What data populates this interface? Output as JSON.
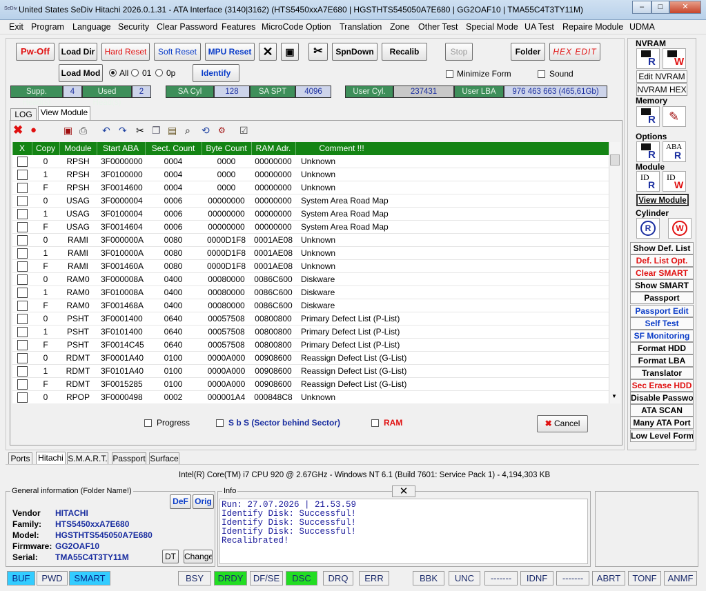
{
  "window": {
    "title": "United States  SeDiv Hitachi  2026.0.1.31 - ATA Interface  (3140|3162)  (HTS5450xxA7E680 | HGSTHTS545050A7E680 | GG2OAF10 | TMA55C4T3TY11M)",
    "app_icon": "SeDiv",
    "min": "–",
    "max": "□",
    "close": "✕"
  },
  "menu": [
    "Exit",
    "Program",
    "Language",
    "Security",
    "Clear Password",
    "Features",
    "MicroCode Option",
    "Translation",
    "Zone",
    "Other Test",
    "Special Mode",
    "UA Test",
    "Repaire Module",
    "UDMA"
  ],
  "toolbar": {
    "pwoff": "Pw-Off",
    "loaddir": "Load Dir",
    "hardreset": "Hard Reset",
    "softreset": "Soft Reset",
    "mpureset": "MPU Reset",
    "spndown": "SpnDown",
    "recalib": "Recalib",
    "stop": "Stop",
    "folder": "Folder",
    "hexedit": "HEX EDIT",
    "loadmod": "Load Mod",
    "radio_all": "All",
    "radio_01": "01",
    "radio_0p": "0p",
    "identify": "Identify",
    "minimize": "Minimize Form",
    "sound": "Sound"
  },
  "infobar": {
    "supp_label": "Supp. Head(s)",
    "supp": "4",
    "used_label": "Used Head(s)",
    "used": "2",
    "sacyl_label": "SA Cyl",
    "sacyl": "128",
    "saspt_label": "SA SPT",
    "saspt": "4096",
    "usercyl_label": "User Cyl.",
    "usercyl": "237431",
    "userlba_label": "User LBA",
    "userlba": "976 463 663  (465,61Gb)"
  },
  "tabs": {
    "log": "LOG",
    "view": "View Module"
  },
  "grid": {
    "headers": [
      "X",
      "Copy",
      "Module",
      "Start ABA",
      "Sect. Count",
      "Byte Count",
      "RAM Adr.",
      "Comment !!!"
    ],
    "rows": [
      [
        "0",
        "RPSH",
        "3F0000000",
        "0004",
        "0000",
        "00000000",
        "Unknown"
      ],
      [
        "1",
        "RPSH",
        "3F0100000",
        "0004",
        "0000",
        "00000000",
        "Unknown"
      ],
      [
        "F",
        "RPSH",
        "3F0014600",
        "0004",
        "0000",
        "00000000",
        "Unknown"
      ],
      [
        "0",
        "USAG",
        "3F0000004",
        "0006",
        "00000000",
        "00000000",
        "System Area Road Map"
      ],
      [
        "1",
        "USAG",
        "3F0100004",
        "0006",
        "00000000",
        "00000000",
        "System Area Road Map"
      ],
      [
        "F",
        "USAG",
        "3F0014604",
        "0006",
        "00000000",
        "00000000",
        "System Area Road Map"
      ],
      [
        "0",
        "RAMI",
        "3F000000A",
        "0080",
        "0000D1F8",
        "0001AE08",
        "Unknown"
      ],
      [
        "1",
        "RAMI",
        "3F010000A",
        "0080",
        "0000D1F8",
        "0001AE08",
        "Unknown"
      ],
      [
        "F",
        "RAMI",
        "3F001460A",
        "0080",
        "0000D1F8",
        "0001AE08",
        "Unknown"
      ],
      [
        "0",
        "RAM0",
        "3F000008A",
        "0400",
        "00080000",
        "0086C600",
        "Diskware"
      ],
      [
        "1",
        "RAM0",
        "3F010008A",
        "0400",
        "00080000",
        "0086C600",
        "Diskware"
      ],
      [
        "F",
        "RAM0",
        "3F001468A",
        "0400",
        "00080000",
        "0086C600",
        "Diskware"
      ],
      [
        "0",
        "PSHT",
        "3F0001400",
        "0640",
        "00057508",
        "00800800",
        "Primary Defect List (P-List)"
      ],
      [
        "1",
        "PSHT",
        "3F0101400",
        "0640",
        "00057508",
        "00800800",
        "Primary Defect List (P-List)"
      ],
      [
        "F",
        "PSHT",
        "3F0014C45",
        "0640",
        "00057508",
        "00800800",
        "Primary Defect List (P-List)"
      ],
      [
        "0",
        "RDMT",
        "3F0001A40",
        "0100",
        "0000A000",
        "00908600",
        "Reassign Defect List (G-List)"
      ],
      [
        "1",
        "RDMT",
        "3F0101A40",
        "0100",
        "0000A000",
        "00908600",
        "Reassign Defect List (G-List)"
      ],
      [
        "F",
        "RDMT",
        "3F0015285",
        "0100",
        "0000A000",
        "00908600",
        "Reassign Defect List (G-List)"
      ],
      [
        "0",
        "RPOP",
        "3F0000498",
        "0002",
        "000001A4",
        "000848C8",
        "Unknown"
      ]
    ]
  },
  "bottom_opts": {
    "progress": "Progress",
    "sbs": "S b S (Sector behind Sector)",
    "ram": "RAM",
    "cancel": "Cancel"
  },
  "right": {
    "nvram": "NVRAM",
    "edit_nvram": "Edit NVRAM",
    "nvram_hex": "NVRAM HEX",
    "memory": "Memory",
    "options": "Options",
    "aba": "ABA",
    "module": "Module",
    "id": "ID",
    "view_module": "View Module",
    "cylinder": "Cylinder",
    "r": "R",
    "w": "W",
    "buttons": [
      {
        "t": "Show Def. List",
        "c": "#000"
      },
      {
        "t": "Def. List Opt.",
        "c": "#e01010"
      },
      {
        "t": "Clear SMART",
        "c": "#e01010"
      },
      {
        "t": "Show SMART",
        "c": "#000"
      },
      {
        "t": "Passport",
        "c": "#000"
      },
      {
        "t": "Passport Edit",
        "c": "#0a3cc8"
      },
      {
        "t": "Self Test",
        "c": "#0a3cc8"
      },
      {
        "t": "SF Monitoring",
        "c": "#0a3cc8"
      },
      {
        "t": "Format HDD",
        "c": "#000"
      },
      {
        "t": "Format LBA",
        "c": "#000"
      },
      {
        "t": "Translator",
        "c": "#000"
      },
      {
        "t": "Sec Erase HDD",
        "c": "#e01010"
      },
      {
        "t": "Disable Password",
        "c": "#000"
      },
      {
        "t": "ATA SCAN",
        "c": "#000"
      },
      {
        "t": "Many ATA Port",
        "c": "#000"
      },
      {
        "t": "Low Level Format",
        "c": "#000"
      }
    ]
  },
  "bottom_tabs": [
    "Ports",
    "Hitachi",
    "S.M.A.R.T.",
    "Passport",
    "Surface"
  ],
  "sysinfo": "Intel(R) Core(TM) i7 CPU 920  @ 2.67GHz - Windows NT 6.1 (Build 7601: Service Pack 1) -  4,194,303 KB",
  "general": {
    "title": "General information (Folder Name!)",
    "def": "DeF",
    "orig": "Orig",
    "vendor_l": "Vendor",
    "vendor": "HITACHI",
    "family_l": "Family:",
    "family": "HTS5450xxA7E680",
    "model_l": "Model:",
    "model": "HGSTHTS545050A7E680",
    "fw_l": "Firmware:",
    "fw": "GG2OAF10",
    "serial_l": "Serial:",
    "serial": "TMA55C4T3TY11M",
    "dt": "DT",
    "change": "Change"
  },
  "log": {
    "title": "Info",
    "lines": "Run: 27.07.2026 | 21.53.59\nIdentify Disk: Successful!\nIdentify Disk: Successful!\nIdentify Disk: Successful!\nRecalibrated!"
  },
  "status": [
    {
      "t": "BUF",
      "bg": "#33ccff"
    },
    {
      "t": "PWD",
      "bg": "#f0f0f0"
    },
    {
      "t": "SMART",
      "bg": "#33ccff"
    },
    {
      "t": "BSY",
      "bg": "#f0f0f0"
    },
    {
      "t": "DRDY",
      "bg": "#22dd22"
    },
    {
      "t": "DF/SE",
      "bg": "#f0f0f0"
    },
    {
      "t": "DSC",
      "bg": "#22dd22"
    },
    {
      "t": "DRQ",
      "bg": "#f0f0f0"
    },
    {
      "t": "ERR",
      "bg": "#f0f0f0"
    },
    {
      "t": "BBK",
      "bg": "#f0f0f0"
    },
    {
      "t": "UNC",
      "bg": "#f0f0f0"
    },
    {
      "t": "-------",
      "bg": "#f0f0f0"
    },
    {
      "t": "IDNF",
      "bg": "#f0f0f0"
    },
    {
      "t": "-------",
      "bg": "#f0f0f0"
    },
    {
      "t": "ABRT",
      "bg": "#f0f0f0"
    },
    {
      "t": "TONF",
      "bg": "#f0f0f0"
    },
    {
      "t": "ANMF",
      "bg": "#f0f0f0"
    }
  ]
}
